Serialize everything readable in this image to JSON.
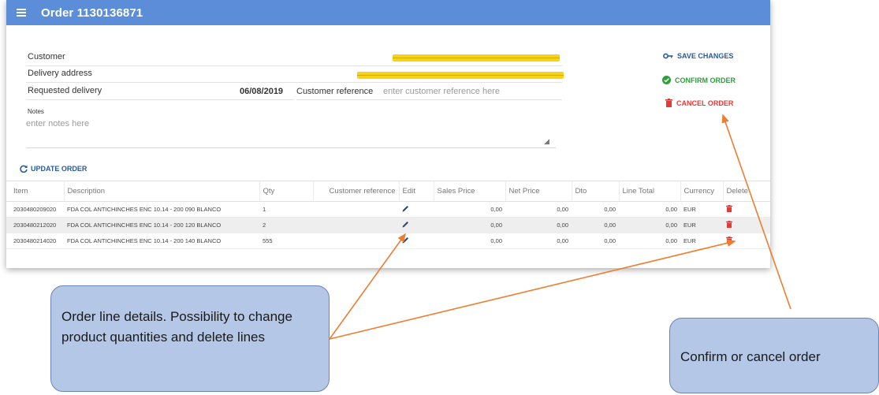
{
  "header": {
    "title": "Order 1130136871"
  },
  "form": {
    "customer_label": "Customer",
    "delivery_address_label": "Delivery address",
    "requested_delivery_label": "Requested delivery",
    "requested_delivery_value": "06/08/2019",
    "customer_reference_label": "Customer reference",
    "customer_reference_placeholder": "enter customer reference here",
    "notes_label": "Notes",
    "notes_placeholder": "enter notes here"
  },
  "actions": {
    "save_label": "SAVE CHANGES",
    "confirm_label": "CONFIRM ORDER",
    "cancel_label": "CANCEL ORDER",
    "update_label": "UPDATE ORDER"
  },
  "colors": {
    "topbar": "#5b8dd9",
    "save": "#2b5a97",
    "confirm": "#2e9e3b",
    "cancel": "#e53935",
    "highlight": "#f7d316"
  },
  "table": {
    "columns": [
      "Item",
      "Description",
      "Qty",
      "Customer reference",
      "Edit",
      "Sales Price",
      "Net Price",
      "Dto",
      "Line Total",
      "Currency",
      "Delete"
    ],
    "rows": [
      {
        "item": "2030480209020",
        "description": "FDA COL ANTICHINCHES ENC 10.14 - 200 090 BLANCO",
        "qty": "1",
        "customer_reference": "",
        "sales_price": "0,00",
        "net_price": "0,00",
        "dto": "0,00",
        "line_total": "0,00",
        "currency": "EUR"
      },
      {
        "item": "2030480212020",
        "description": "FDA COL ANTICHINCHES ENC 10.14 - 200 120 BLANCO",
        "qty": "2",
        "customer_reference": "",
        "sales_price": "0,00",
        "net_price": "0,00",
        "dto": "0,00",
        "line_total": "0,00",
        "currency": "EUR"
      },
      {
        "item": "2030480214020",
        "description": "FDA COL ANTICHINCHES ENC 10.14 - 200 140 BLANCO",
        "qty": "555",
        "customer_reference": "",
        "sales_price": "0,00",
        "net_price": "0,00",
        "dto": "0,00",
        "line_total": "0,00",
        "currency": "EUR"
      }
    ]
  },
  "annotations": {
    "left_callout": "Order line details. Possibility to change product quantities and delete lines",
    "right_callout": "Confirm or cancel order",
    "callout_color": "#b4c7e7",
    "arrow_color": "#ed7d31"
  }
}
